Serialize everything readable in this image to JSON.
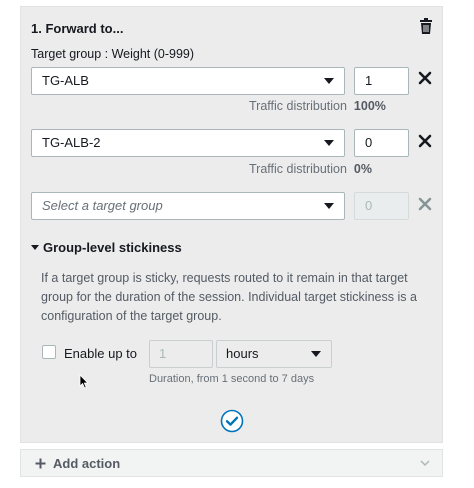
{
  "action": {
    "title": "1. Forward to...",
    "target_group_label": "Target group : Weight (0-999)"
  },
  "targets": [
    {
      "group": "TG-ALB",
      "weight": "1",
      "dist_label": "Traffic distribution",
      "dist_value": "100%"
    },
    {
      "group": "TG-ALB-2",
      "weight": "0",
      "dist_label": "Traffic distribution",
      "dist_value": "0%"
    }
  ],
  "new_target": {
    "placeholder": "Select a target group",
    "weight": "0"
  },
  "stickiness": {
    "heading": "Group-level stickiness",
    "description": "If a target group is sticky, requests routed to it remain in that target group for the duration of the session. Individual target stickiness is a configuration of the target group.",
    "enable_label": "Enable up to",
    "enabled": false,
    "duration_value": "1",
    "unit": "hours",
    "hint": "Duration, from 1 second to 7 days"
  },
  "footer": {
    "add_action_label": "Add action"
  },
  "icons": {
    "delete": "trash-icon",
    "remove": "close-icon",
    "confirm": "check-circle-icon",
    "add": "plus-icon",
    "expand": "chevron-down-icon",
    "collapse": "caret-down-icon"
  },
  "colors": {
    "accent": "#0073bb",
    "panel": "#ececec",
    "muted": "#687078"
  }
}
